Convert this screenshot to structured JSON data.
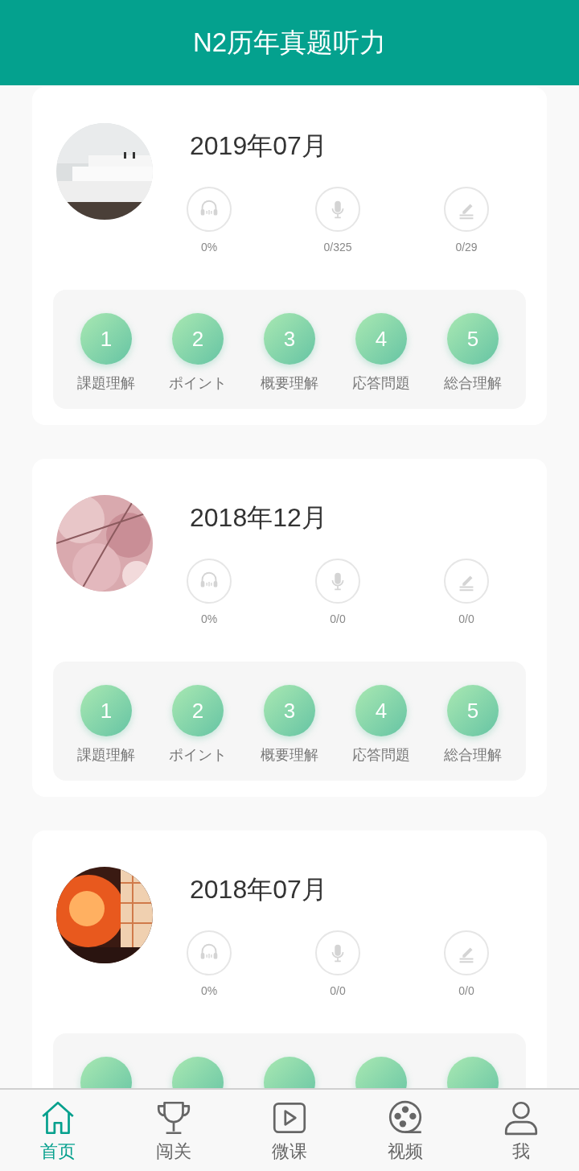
{
  "header": {
    "title": "N2历年真题听力"
  },
  "papers": [
    {
      "title": "2019年07月",
      "stats": [
        {
          "value": "0%"
        },
        {
          "value": "0/325"
        },
        {
          "value": "0/29"
        }
      ],
      "sections": [
        {
          "kind": "numbered",
          "number": "1",
          "label": "課題理解"
        },
        {
          "kind": "numbered",
          "number": "2",
          "label": "ポイント"
        },
        {
          "kind": "numbered",
          "number": "3",
          "label": "概要理解"
        },
        {
          "kind": "numbered",
          "number": "4",
          "label": "応答問題"
        },
        {
          "kind": "numbered",
          "number": "5",
          "label": "総合理解"
        }
      ]
    },
    {
      "title": "2018年12月",
      "stats": [
        {
          "value": "0%"
        },
        {
          "value": "0/0"
        },
        {
          "value": "0/0"
        }
      ],
      "sections": [
        {
          "kind": "numbered",
          "number": "1",
          "label": "課題理解"
        },
        {
          "kind": "numbered",
          "number": "2",
          "label": "ポイント"
        },
        {
          "kind": "numbered",
          "number": "3",
          "label": "概要理解"
        },
        {
          "kind": "numbered",
          "number": "4",
          "label": "応答問題"
        },
        {
          "kind": "numbered",
          "number": "5",
          "label": "総合理解"
        }
      ]
    },
    {
      "title": "2018年07月",
      "stats": [
        {
          "value": "0%"
        },
        {
          "value": "0/0"
        },
        {
          "value": "0/0"
        }
      ],
      "sections": [
        {
          "kind": "covered"
        },
        {
          "kind": "covered"
        },
        {
          "kind": "covered"
        },
        {
          "kind": "covered"
        },
        {
          "kind": "covered"
        }
      ]
    }
  ],
  "tab_bar": {
    "items": [
      {
        "label": "首页",
        "selected": true
      },
      {
        "label": "闯关",
        "selected": false
      },
      {
        "label": "微课",
        "selected": false
      },
      {
        "label": "视频",
        "selected": false
      },
      {
        "label": "我",
        "selected": false
      }
    ]
  }
}
